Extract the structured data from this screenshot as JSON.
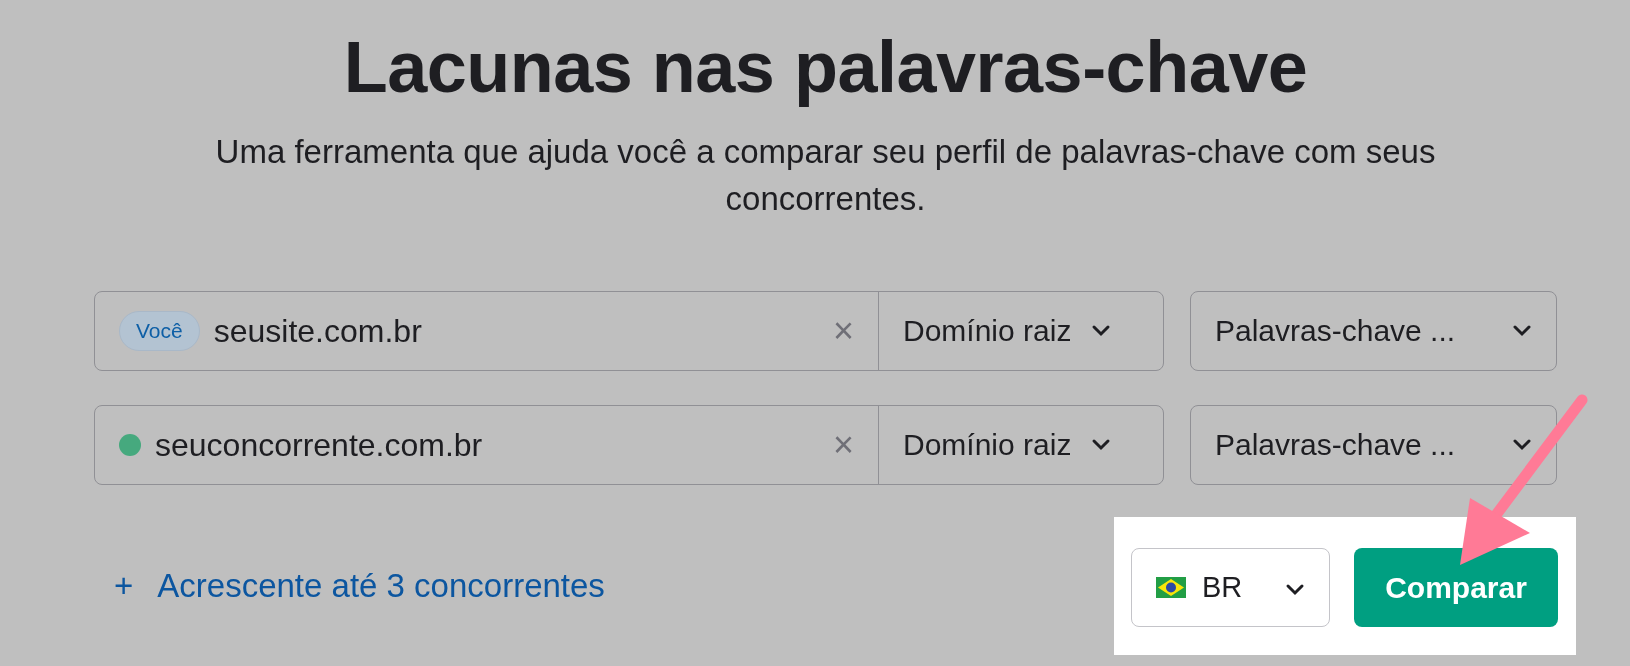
{
  "title": "Lacunas nas palavras-chave",
  "subtitle": "Uma ferramenta que ajuda você a comparar seu perfil de palavras-chave com seus concorrentes.",
  "rows": [
    {
      "kind": "you",
      "badge": "Você",
      "value": "seusite.com.br",
      "clear": "×",
      "scope": "Domínio raiz",
      "type": "Palavras-chave ..."
    },
    {
      "kind": "competitor",
      "color": "#46a97e",
      "value": "seuconcorrente.com.br",
      "clear": "×",
      "scope": "Domínio raiz",
      "type": "Palavras-chave ..."
    }
  ],
  "add_link": {
    "icon": "+",
    "label": "Acrescente até 3 concorrentes"
  },
  "country": {
    "code": "BR"
  },
  "submit": "Comparar"
}
